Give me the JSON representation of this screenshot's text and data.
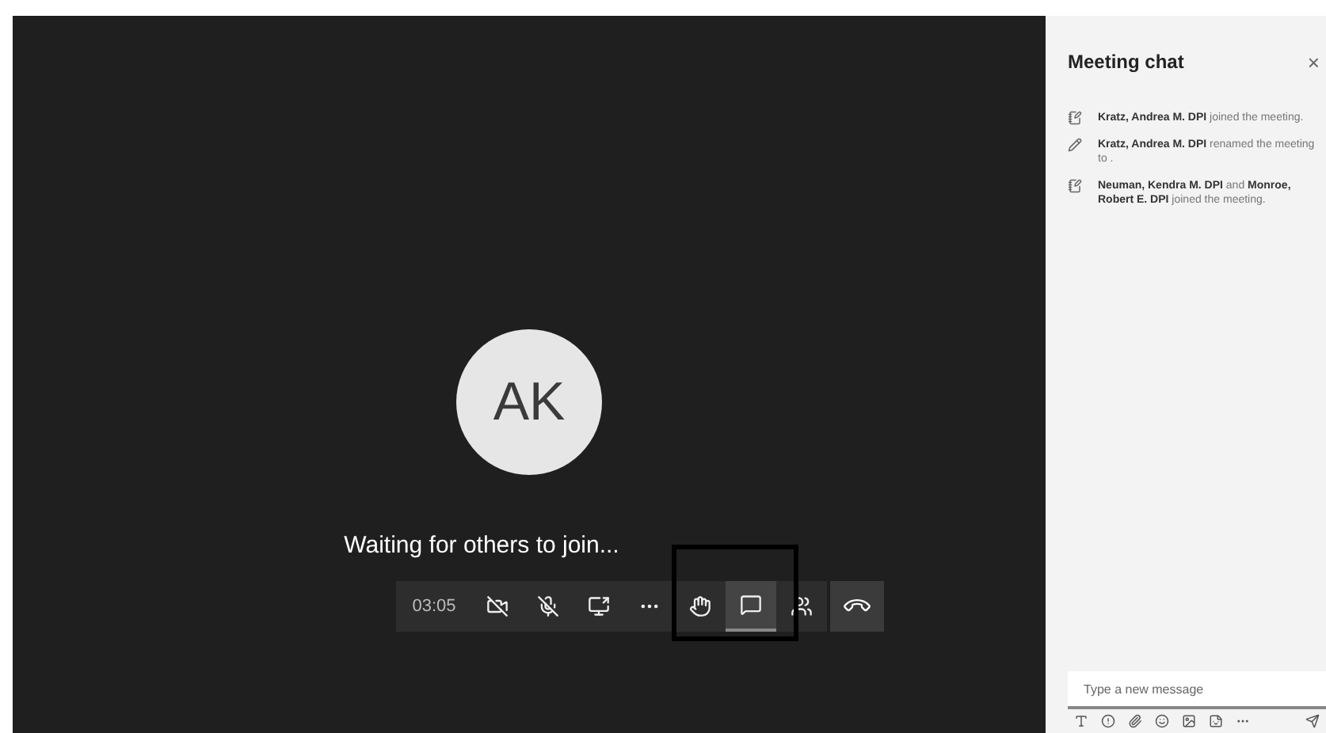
{
  "stage": {
    "avatar_initials": "AK",
    "status": "Waiting for others to join..."
  },
  "call_controls": {
    "timer": "03:05",
    "buttons": [
      {
        "kind": "camera",
        "selected": false
      },
      {
        "kind": "mic",
        "selected": false
      },
      {
        "kind": "share",
        "selected": false
      },
      {
        "kind": "more",
        "selected": false
      },
      {
        "kind": "hand",
        "selected": false
      },
      {
        "kind": "chat",
        "selected": true
      },
      {
        "kind": "people",
        "selected": false
      }
    ],
    "hang_up": true
  },
  "chat": {
    "title": "Meeting chat",
    "close": "×",
    "messages": [
      {
        "kind": "joined",
        "text": "**Kratz, Andrea M. DPI** joined the meeting."
      },
      {
        "kind": "renamed",
        "text": "**Kratz, Andrea M. DPI** renamed the meeting to ."
      },
      {
        "kind": "joined",
        "text": "**Neuman, Kendra M. DPI** and **Monroe, Robert E. DPI** joined the meeting."
      }
    ],
    "composer": {
      "placeholder": "Type a new message"
    }
  }
}
